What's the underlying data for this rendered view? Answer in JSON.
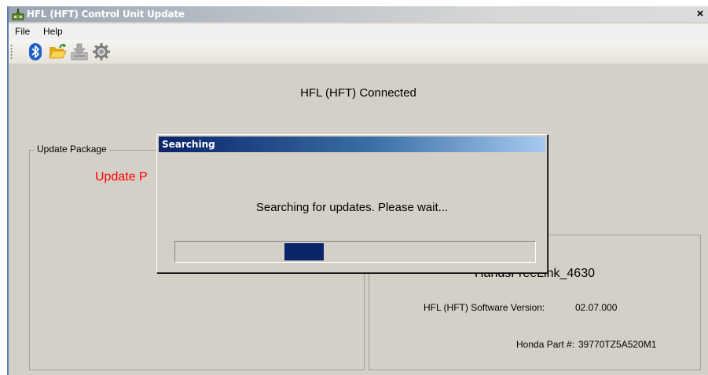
{
  "window": {
    "title": "HFL (HFT) Control Unit Update",
    "close_glyph": "×"
  },
  "menu": {
    "items": [
      "File",
      "Help"
    ]
  },
  "toolbar": {
    "buttons": [
      "bluetooth-icon",
      "open-folder-icon",
      "download-update-icon",
      "settings-gear-icon"
    ]
  },
  "main": {
    "connection_status": "HFL (HFT) Connected",
    "update_package": {
      "legend": "Update Package",
      "status": "Update P"
    },
    "device_info": {
      "name": "HandsFreeLink_4630",
      "software_version_label": "HFL (HFT) Software Version:",
      "software_version_value": "02.07.000",
      "part_number_label": "Honda Part #:",
      "part_number_value": "39770TZ5A520M1"
    }
  },
  "dialog": {
    "title": "Searching",
    "message": "Searching for updates. Please wait...",
    "progress_state": "indeterminate (marquee)"
  },
  "colors": {
    "window_bg": "#d4d0c8",
    "accent_navy": "#0a246a",
    "status_red": "#ff0000"
  }
}
